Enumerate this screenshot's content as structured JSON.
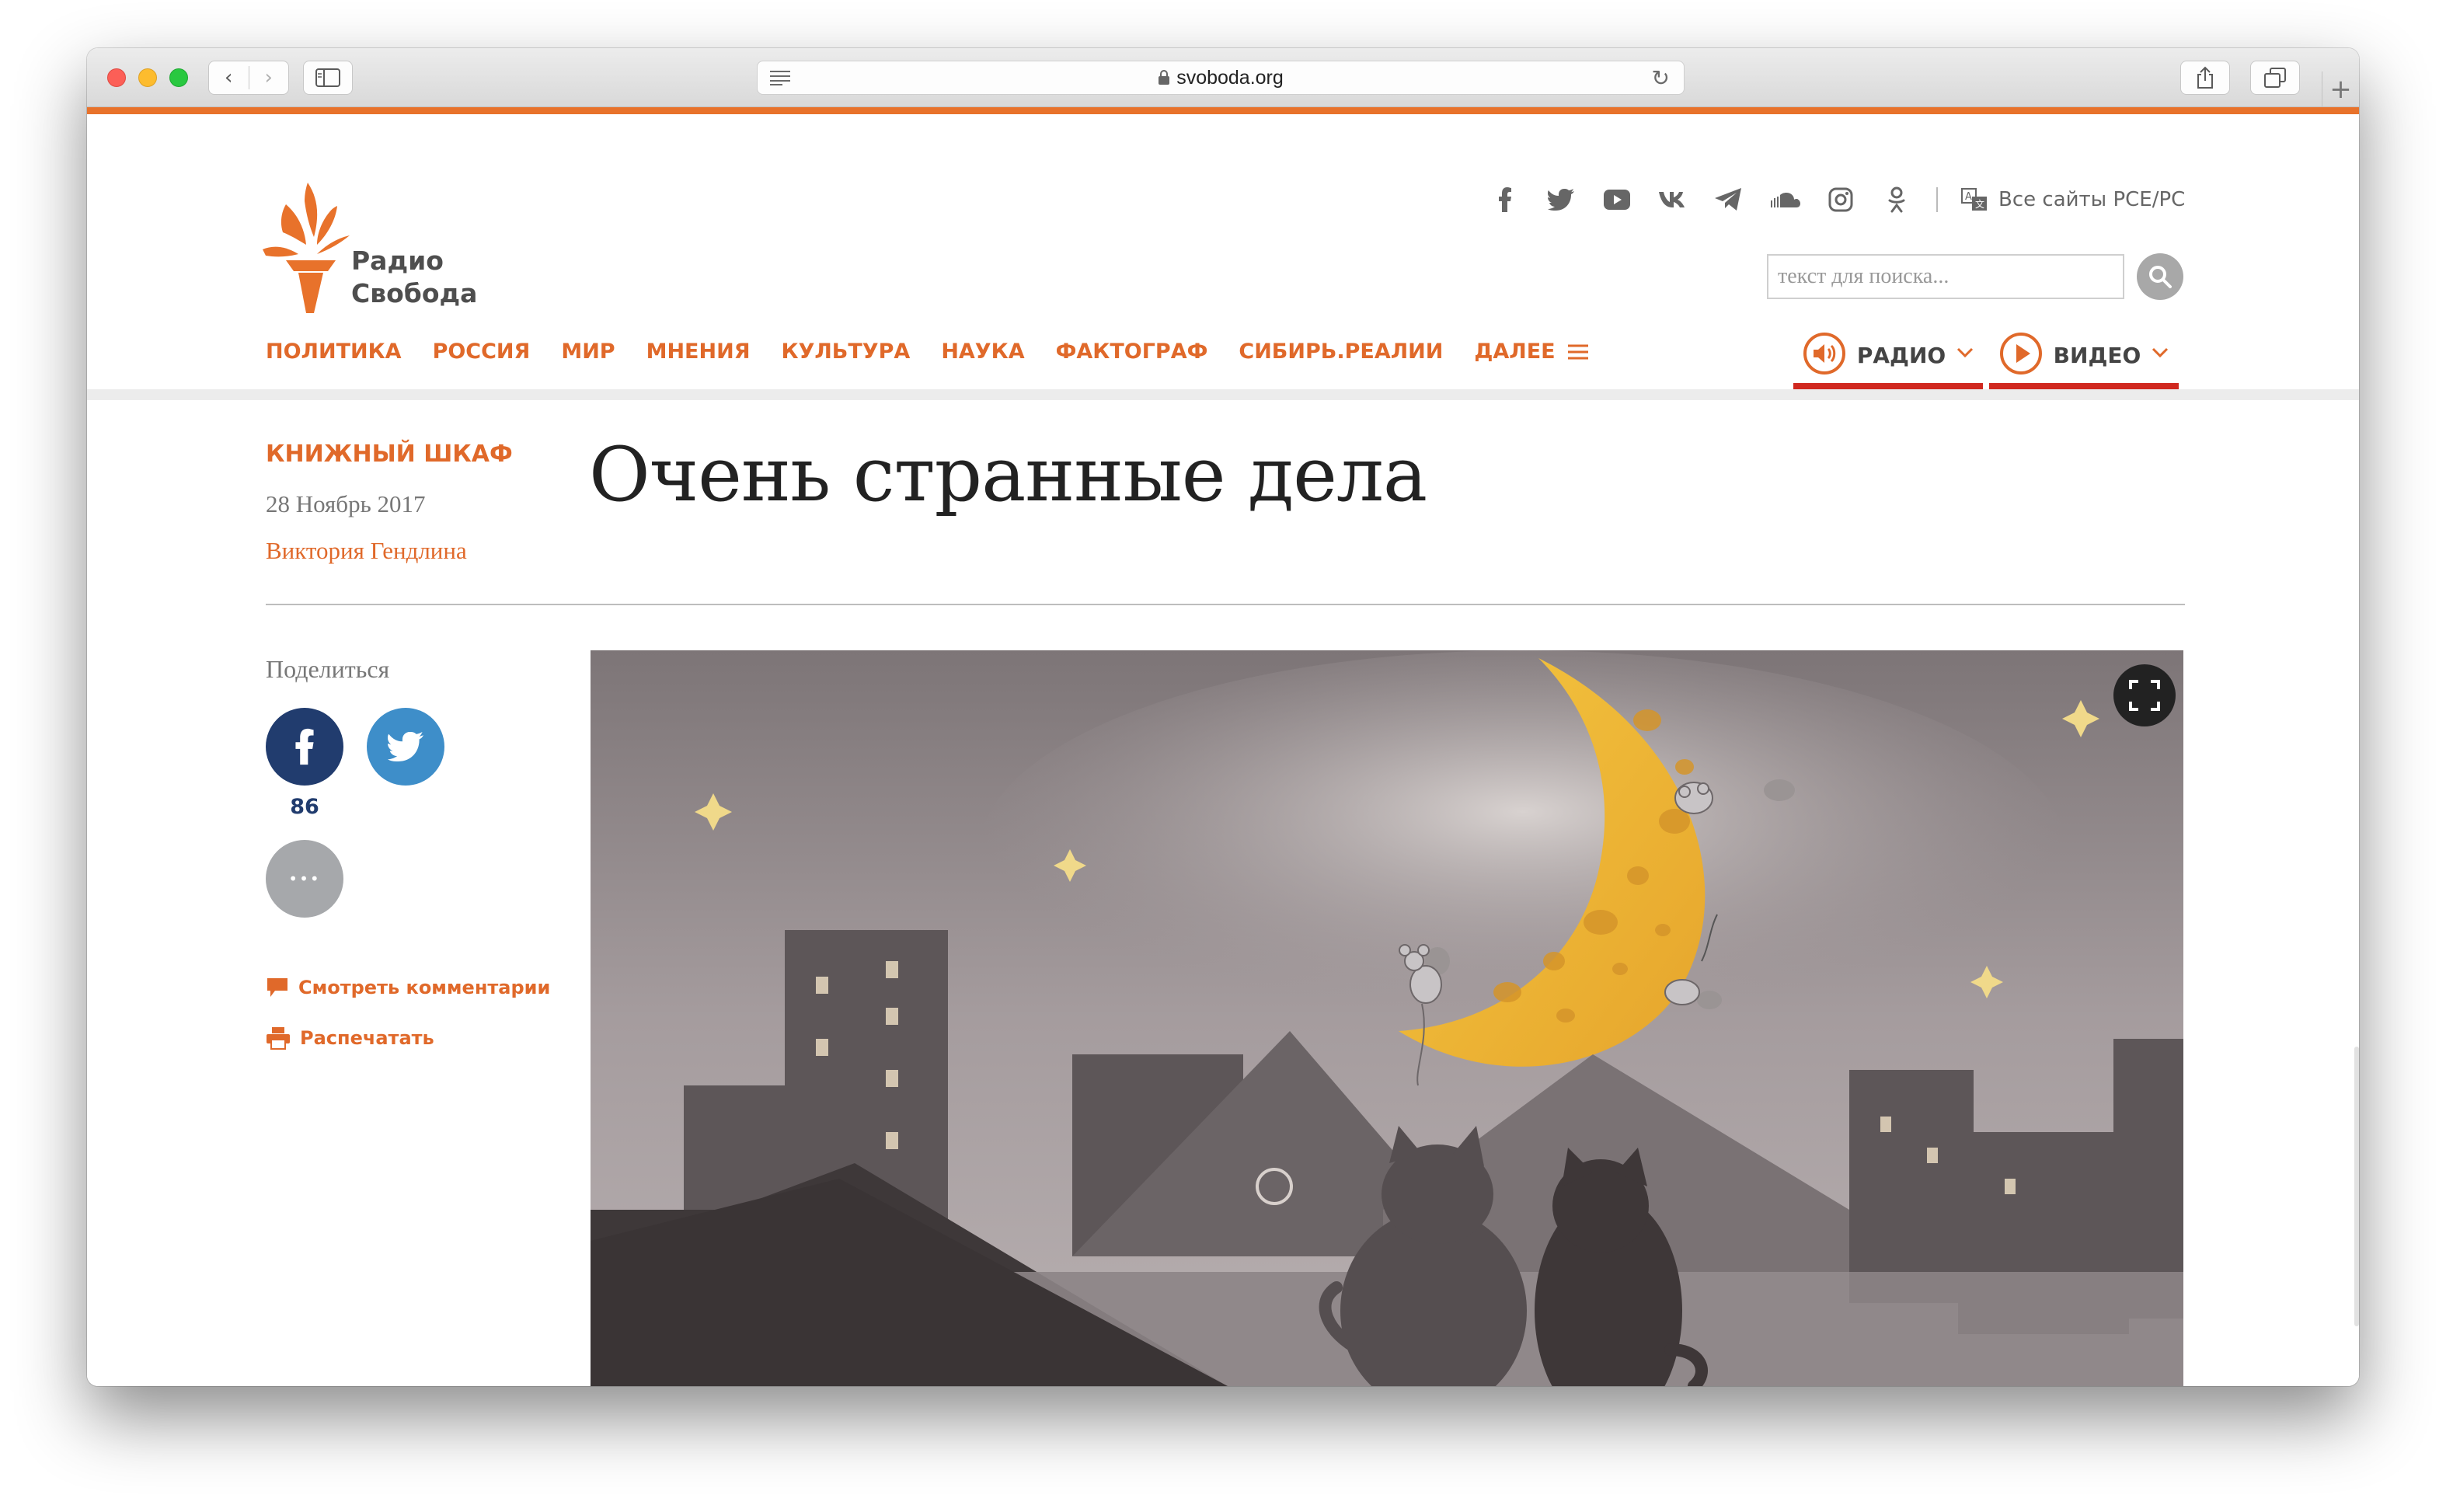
{
  "browser": {
    "url": "svoboda.org",
    "nav_back": "‹",
    "nav_forward": "›",
    "new_tab": "+",
    "reload": "↻"
  },
  "site": {
    "logo_line1": "Радио",
    "logo_line2": "Свобода",
    "brand_color": "#e8722b",
    "all_sites": "Все сайты РСЕ/РС",
    "social_icons": [
      "facebook-icon",
      "twitter-icon",
      "youtube-icon",
      "vk-icon",
      "telegram-icon",
      "soundcloud-icon",
      "instagram-icon",
      "odnoklassniki-icon"
    ],
    "search_placeholder": "текст для поиска..."
  },
  "nav": {
    "items": [
      "ПОЛИТИКА",
      "РОССИЯ",
      "МИР",
      "МНЕНИЯ",
      "КУЛЬТУРА",
      "НАУКА",
      "ФАКТОГРАФ",
      "СИБИРЬ.РЕАЛИИ"
    ],
    "more": "ДАЛЕЕ",
    "radio": "РАДИО",
    "video": "ВИДЕО"
  },
  "article": {
    "section": "КНИЖНЫЙ ШКАФ",
    "date": "28 Ноябрь 2017",
    "author": "Виктория Гендлина",
    "title": "Очень странные дела"
  },
  "share": {
    "label": "Поделиться",
    "facebook_count": "86",
    "more_glyph": "•••",
    "comments": "Смотреть комментарии",
    "print": "Распечатать"
  }
}
